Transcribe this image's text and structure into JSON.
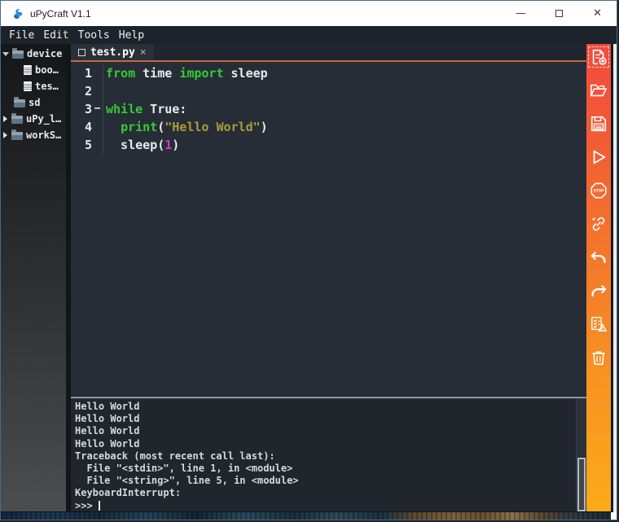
{
  "window": {
    "title": "uPyCraft V1.1",
    "controls": {
      "minimize_glyph": "—",
      "close_glyph": "✕"
    }
  },
  "menu": {
    "items": [
      "File",
      "Edit",
      "Tools",
      "Help"
    ]
  },
  "sidebar": {
    "items": [
      {
        "label": "device",
        "type": "folder",
        "state": "expanded",
        "indent": 0
      },
      {
        "label": "boo…",
        "type": "file",
        "state": "none",
        "indent": 2
      },
      {
        "label": "tes…",
        "type": "file",
        "state": "none",
        "indent": 2
      },
      {
        "label": "sd",
        "type": "folder",
        "state": "none",
        "indent": 1
      },
      {
        "label": "uPy_l…",
        "type": "folder",
        "state": "collapsed",
        "indent": 0
      },
      {
        "label": "workS…",
        "type": "folder",
        "state": "collapsed",
        "indent": 0
      }
    ]
  },
  "tab": {
    "label": "test.py",
    "close_glyph": "×"
  },
  "editor": {
    "colors": {
      "keyword": "#33cc33",
      "string": "#ab9d3b",
      "number": "#cc3fcc",
      "plain": "#e8eaec",
      "active_tab_underline": "#c06a3e",
      "editor_bg": "#272d36",
      "console_bg": "#21262d"
    },
    "lines": [
      {
        "num": "1",
        "fold": "",
        "tokens": [
          {
            "text": "from",
            "cls": "kw"
          },
          {
            "text": " time ",
            "cls": "pl"
          },
          {
            "text": "import",
            "cls": "kw"
          },
          {
            "text": " sleep",
            "cls": "pl"
          }
        ]
      },
      {
        "num": "2",
        "fold": "",
        "tokens": []
      },
      {
        "num": "3",
        "fold": "−",
        "tokens": [
          {
            "text": "while",
            "cls": "kw"
          },
          {
            "text": " True:",
            "cls": "pl"
          }
        ]
      },
      {
        "num": "4",
        "fold": "",
        "tokens": [
          {
            "text": "  ",
            "cls": "pl"
          },
          {
            "text": "print",
            "cls": "kw"
          },
          {
            "text": "(",
            "cls": "pl"
          },
          {
            "text": "\"Hello World\"",
            "cls": "str"
          },
          {
            "text": ")",
            "cls": "pl"
          }
        ]
      },
      {
        "num": "5",
        "fold": "",
        "tokens": [
          {
            "text": "  sleep(",
            "cls": "pl"
          },
          {
            "text": "1",
            "cls": "num"
          },
          {
            "text": ")",
            "cls": "pl"
          }
        ]
      }
    ]
  },
  "console": {
    "lines": [
      "Hello World",
      "Hello World",
      "Hello World",
      "Hello World",
      "Traceback (most recent call last):",
      "  File \"<stdin>\", line 1, in <module>",
      "  File \"<string>\", line 5, in <module>",
      "KeyboardInterrupt:"
    ],
    "prompt": ">>>"
  },
  "toolbar": {
    "gradient_top": "#f24a3e",
    "gradient_bottom": "#fbab19",
    "buttons": [
      {
        "name": "new-file"
      },
      {
        "name": "open-file"
      },
      {
        "name": "save-file"
      },
      {
        "name": "download-run"
      },
      {
        "name": "stop"
      },
      {
        "name": "connect"
      },
      {
        "name": "undo"
      },
      {
        "name": "redo"
      },
      {
        "name": "syntax-check"
      },
      {
        "name": "clear"
      }
    ]
  }
}
